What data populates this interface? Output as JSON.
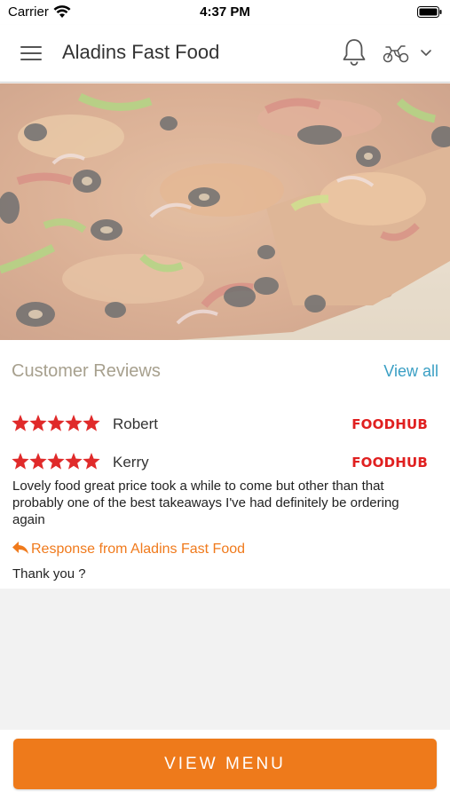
{
  "status_bar": {
    "carrier": "Carrier",
    "time": "4:37 PM"
  },
  "header": {
    "title": "Aladins Fast Food",
    "icons": [
      "menu-icon",
      "bell-icon",
      "scooter-icon",
      "chevron-down-icon"
    ]
  },
  "hero": {
    "image": "pizza-photo"
  },
  "reviews": {
    "title": "Customer Reviews",
    "view_all_label": "View all",
    "items": [
      {
        "name": "Robert",
        "rating": 5,
        "source": "FOODHUB"
      },
      {
        "name": "Kerry",
        "rating": 5,
        "source": "FOODHUB",
        "text": "Lovely food great price took a while to come but other than that probably one of the best takeaways I've had definitely be ordering again",
        "response_label": "Response from Aladins Fast Food",
        "response_text": "Thank you ?"
      }
    ]
  },
  "footer": {
    "button_label": "VIEW MENU"
  },
  "colors": {
    "accent": "#ee7a1b",
    "link": "#3a9fc4",
    "star": "#e02a2a",
    "brand_logo": "#e02020",
    "section_title": "#a7a08e"
  }
}
